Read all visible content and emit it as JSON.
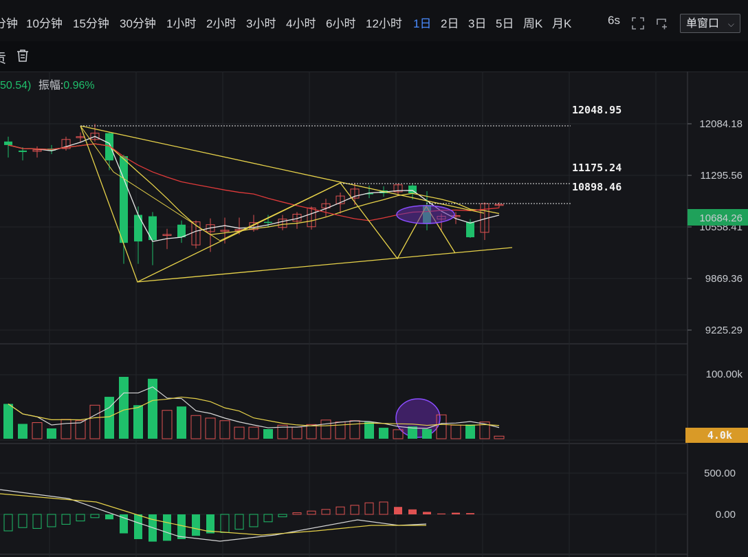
{
  "timeframes": [
    {
      "label": "分钟",
      "active": false
    },
    {
      "label": "10分钟",
      "active": false
    },
    {
      "label": "15分钟",
      "active": false
    },
    {
      "label": "30分钟",
      "active": false
    },
    {
      "label": "1小时",
      "active": false
    },
    {
      "label": "2小时",
      "active": false
    },
    {
      "label": "3小时",
      "active": false
    },
    {
      "label": "4小时",
      "active": false
    },
    {
      "label": "6小时",
      "active": false
    },
    {
      "label": "12小时",
      "active": false
    },
    {
      "label": "1日",
      "active": true
    },
    {
      "label": "2日",
      "active": false
    },
    {
      "label": "3日",
      "active": false
    },
    {
      "label": "5日",
      "active": false
    },
    {
      "label": "周K",
      "active": false
    },
    {
      "label": "月K",
      "active": false
    }
  ],
  "refresh": "6s",
  "window_mode": "单窗口",
  "toolbar": {
    "left_char": "贡"
  },
  "info": {
    "prefix": "50.54)",
    "amplitude_label": "振幅:",
    "amplitude_value": "0.96%"
  },
  "colors": {
    "up": "#e05252",
    "down": "#1fbf6b",
    "accent": "#4a8cff",
    "yellow": "#e8d34a",
    "current_price_bg": "#1fa15a",
    "vol_badge_bg": "#d99a27"
  },
  "price_axis": {
    "ticks": [
      "12084.18",
      "11295.56",
      "10558.41",
      "9869.36",
      "9225.29"
    ],
    "current_price": "10684.26"
  },
  "annotations": [
    "12048.95",
    "11175.24",
    "10898.46"
  ],
  "volume_axis": {
    "ticks": [
      "100.00k"
    ],
    "current": "4.0k"
  },
  "macd_axis": {
    "ticks": [
      "500.00",
      "0.00"
    ]
  },
  "chart_data": {
    "type": "candlestick",
    "candles": [
      [
        11830,
        11780,
        11900,
        11600
      ],
      [
        11700,
        11680,
        11750,
        11560
      ],
      [
        11690,
        11710,
        11760,
        11600
      ],
      [
        11730,
        11700,
        11780,
        11650
      ],
      [
        11730,
        11860,
        11900,
        11700
      ],
      [
        11890,
        11900,
        11960,
        11820
      ],
      [
        11860,
        11950,
        12084,
        11830
      ],
      [
        11950,
        11560,
        11960,
        11420
      ],
      [
        11620,
        10380,
        11640,
        10080
      ],
      [
        10780,
        10400,
        10900,
        10080
      ],
      [
        10760,
        10420,
        10820,
        10060
      ],
      [
        10500,
        10500,
        10580,
        10290
      ],
      [
        10640,
        10460,
        10700,
        10380
      ],
      [
        10350,
        10680,
        10700,
        10300
      ],
      [
        10540,
        10640,
        10730,
        10250
      ],
      [
        10560,
        10560,
        10740,
        10370
      ],
      [
        10560,
        10570,
        10740,
        10500
      ],
      [
        10570,
        10670,
        10780,
        10540
      ],
      [
        10680,
        10670,
        10780,
        10600
      ],
      [
        10600,
        10720,
        10780,
        10560
      ],
      [
        10690,
        10790,
        10820,
        10580
      ],
      [
        10610,
        10880,
        10900,
        10570
      ],
      [
        10880,
        10940,
        11010,
        10750
      ],
      [
        10940,
        11050,
        11100,
        10800
      ],
      [
        11020,
        11150,
        11240,
        10920
      ],
      [
        11090,
        11080,
        11200,
        11020
      ],
      [
        11130,
        11090,
        11190,
        11040
      ],
      [
        11110,
        11210,
        11230,
        11060
      ],
      [
        11200,
        11090,
        11230,
        11000
      ],
      [
        10920,
        10650,
        11120,
        10560
      ],
      [
        10720,
        10760,
        10800,
        10540
      ],
      [
        10760,
        10770,
        10820,
        10650
      ],
      [
        10680,
        10460,
        10720,
        10450
      ],
      [
        10530,
        10940,
        10960,
        10420
      ],
      [
        10920,
        10930,
        10960,
        10880
      ]
    ],
    "volume": [
      54,
      23,
      25,
      16,
      30,
      28,
      52,
      65,
      96,
      52,
      93,
      44,
      50,
      36,
      32,
      28,
      18,
      18,
      15,
      21,
      18,
      22,
      29,
      26,
      28,
      26,
      17,
      14,
      19,
      15,
      37,
      21,
      22,
      26,
      4
    ],
    "macd_hist": [
      -200,
      -160,
      -170,
      -150,
      -120,
      -80,
      -40,
      -60,
      -230,
      -300,
      -330,
      -320,
      -300,
      -260,
      -230,
      -220,
      -180,
      -150,
      -90,
      -30,
      20,
      40,
      60,
      90,
      110,
      140,
      150,
      90,
      60,
      30,
      10,
      20,
      15
    ]
  }
}
